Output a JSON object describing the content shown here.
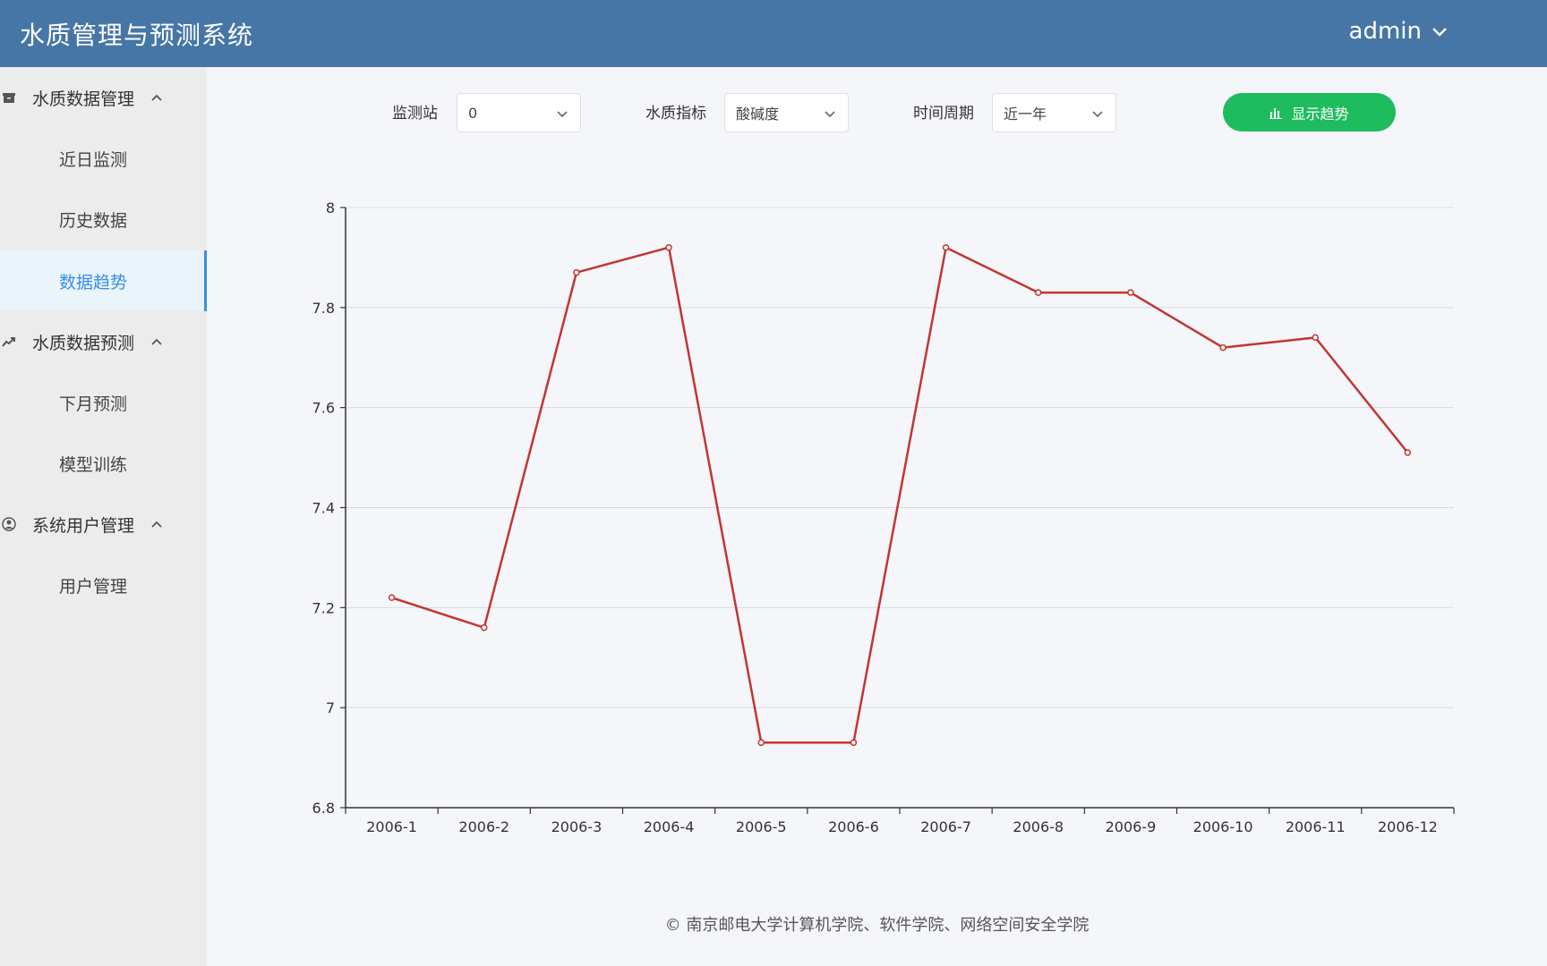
{
  "header": {
    "title": "水质管理与预测系统",
    "user": "admin"
  },
  "sidebar": {
    "groups": [
      {
        "label": "水质数据管理",
        "icon": "archive-icon",
        "items": [
          "近日监测",
          "历史数据",
          "数据趋势"
        ]
      },
      {
        "label": "水质数据预测",
        "icon": "trend-icon",
        "items": [
          "下月预测",
          "模型训练"
        ]
      },
      {
        "label": "系统用户管理",
        "icon": "user-icon",
        "items": [
          "用户管理"
        ]
      }
    ],
    "active_item": "数据趋势"
  },
  "filters": {
    "station": {
      "label": "监测站",
      "value": "0"
    },
    "indicator": {
      "label": "水质指标",
      "value": "酸碱度"
    },
    "period": {
      "label": "时间周期",
      "value": "近一年"
    },
    "button": {
      "label": "显示趋势",
      "icon": "bar-chart-icon"
    }
  },
  "chart_data": {
    "type": "line",
    "categories": [
      "2006-1",
      "2006-2",
      "2006-3",
      "2006-4",
      "2006-5",
      "2006-6",
      "2006-7",
      "2006-8",
      "2006-9",
      "2006-10",
      "2006-11",
      "2006-12"
    ],
    "values": [
      7.22,
      7.16,
      7.87,
      7.92,
      6.93,
      6.93,
      7.92,
      7.83,
      7.83,
      7.72,
      7.74,
      7.51
    ],
    "ylim": [
      6.8,
      8
    ],
    "yticks": [
      6.8,
      7,
      7.2,
      7.4,
      7.6,
      7.8,
      8
    ],
    "ytick_labels": [
      "6.8",
      "7",
      "7.2",
      "7.4",
      "7.6",
      "7.8",
      "8"
    ],
    "grid": true,
    "line_color": "#c23531"
  },
  "footer": "© 南京邮电大学计算机学院、软件学院、网络空间安全学院"
}
